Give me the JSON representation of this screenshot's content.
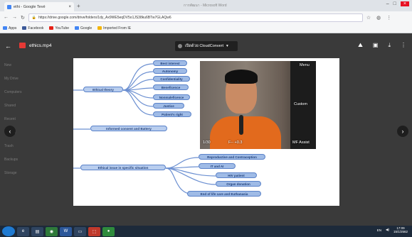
{
  "browser": {
    "tab_title": "ethi - Google Tevé",
    "window_title": "การพัฒนา - Microsoft Word",
    "url": "https://drive.google.com/drive/folders/1dy_Ax9WE5eqDV5o1JS38ku6BTw7GLAQw6",
    "bookmarks": [
      {
        "label": "Apps",
        "color": "#4285f4"
      },
      {
        "label": "Facebook",
        "color": "#3b5998"
      },
      {
        "label": "YouTube",
        "color": "#e62117"
      },
      {
        "label": "Google",
        "color": "#4285f4"
      },
      {
        "label": "Imported From IE",
        "color": "#f4b400"
      }
    ]
  },
  "viewer": {
    "file_name": "ethics.mp4",
    "open_with": "เปิดด้วย CloudConvert",
    "sidebar_items": [
      "New",
      "My Drive",
      "Computers",
      "Shared",
      "Recent",
      "Starred",
      "Trash",
      "Backups",
      "Storage"
    ]
  },
  "slide": {
    "center_top": "Ethical theory",
    "theory_items": [
      "Best interest",
      "Autonomy",
      "Confidentiality",
      "Beneficence",
      "Nonmaleficence",
      "Justice",
      "Patient's right"
    ],
    "informed_consent": "Informed consent and Battery",
    "center_bottom": "Ethical issue in specific situation",
    "situation_items": [
      "Reproductive and Contraception",
      "IT and AI",
      "HIV patient",
      "Organ donation",
      "End of life care and Euthanasia"
    ]
  },
  "video": {
    "menu_label": "Menu",
    "custom_label": "Custom",
    "counter": "1/30",
    "exposure": "F-- +0.3",
    "mf_label": "MF Assist"
  },
  "below_slide": {
    "row_left": "",
    "row_right": ""
  },
  "taskbar": {
    "time": "17:09",
    "date": "15/1/2562",
    "lang": "EN"
  }
}
